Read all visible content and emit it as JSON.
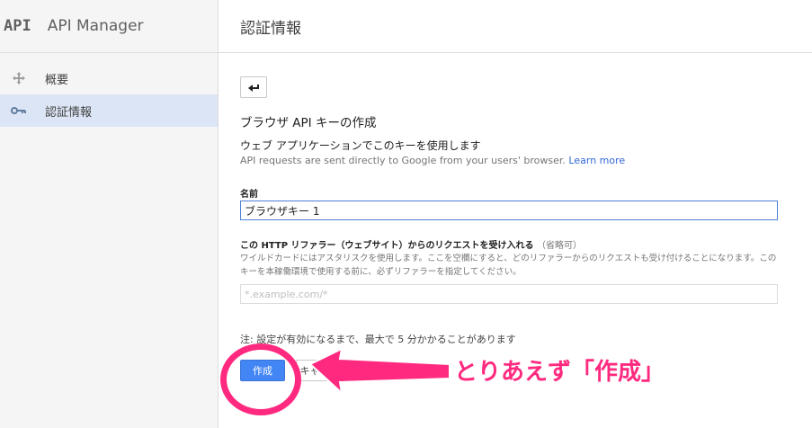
{
  "app": {
    "logo": "API",
    "title": "API Manager"
  },
  "sidebar": {
    "items": [
      {
        "label": "概要",
        "icon": "move-icon",
        "active": false
      },
      {
        "label": "認証情報",
        "icon": "key-icon",
        "active": true
      }
    ]
  },
  "header": {
    "title": "認証情報"
  },
  "form": {
    "back_icon": "back-arrow-icon",
    "section_title": "ブラウザ API キーの作成",
    "subtitle": "ウェブ アプリケーションでこのキーを使用します",
    "description": "API requests are sent directly to Google from your users' browser.",
    "learn_more": "Learn more",
    "name_label": "名前",
    "name_value": "ブラウザキー 1",
    "referrer_label": "この HTTP リファラー（ウェブサイト）からのリクエストを受け入れる",
    "referrer_optional": "（省略可）",
    "referrer_help": "ワイルドカードにはアスタリスクを使用します。ここを空欄にすると、どのリファラーからのリクエストも受け付けることになります。このキーを本稼働環境で使用する前に、必ずリファラーを指定してください。",
    "referrer_placeholder": "*.example.com/*",
    "note": "注: 設定が有効になるまで、最大で 5 分かかることがあります",
    "create_label": "作成",
    "cancel_label": "キャンセル"
  },
  "annotation": {
    "text": "とりあえず「作成」",
    "color": "#ff2a7f"
  },
  "colors": {
    "accent": "#4285f4",
    "link": "#3367d6",
    "active_nav": "#dce5f5",
    "annotation": "#ff2a7f"
  }
}
